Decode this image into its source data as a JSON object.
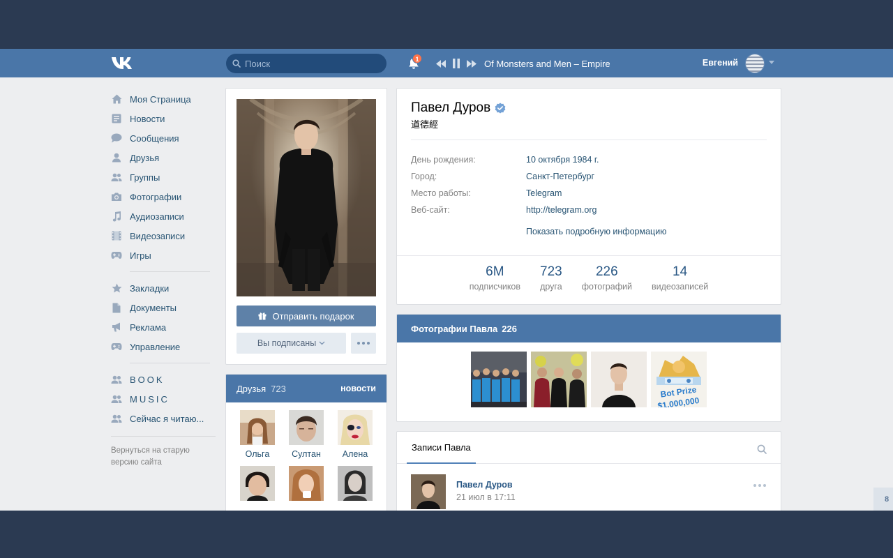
{
  "header": {
    "search_placeholder": "Поиск",
    "notifications_count": "1",
    "track": "Of Monsters and Men – Empire",
    "username": "Евгений"
  },
  "sidebar": {
    "main_items": [
      {
        "label": "Моя Страница",
        "icon": "home-icon"
      },
      {
        "label": "Новости",
        "icon": "news-icon"
      },
      {
        "label": "Сообщения",
        "icon": "messages-icon"
      },
      {
        "label": "Друзья",
        "icon": "friend-icon"
      },
      {
        "label": "Группы",
        "icon": "groups-icon"
      },
      {
        "label": "Фотографии",
        "icon": "camera-icon"
      },
      {
        "label": "Аудиозаписи",
        "icon": "music-note-icon"
      },
      {
        "label": "Видеозаписи",
        "icon": "film-icon"
      },
      {
        "label": "Игры",
        "icon": "gamepad-icon"
      }
    ],
    "secondary_items": [
      {
        "label": "Закладки",
        "icon": "star-icon"
      },
      {
        "label": "Документы",
        "icon": "document-icon"
      },
      {
        "label": "Реклама",
        "icon": "megaphone-icon"
      },
      {
        "label": "Управление",
        "icon": "gamepad-icon"
      }
    ],
    "group_items": [
      {
        "label": "BOOK",
        "icon": "groups-icon"
      },
      {
        "label": "MUSIC",
        "icon": "groups-icon"
      },
      {
        "label": "Сейчас я читаю...",
        "icon": "groups-icon"
      }
    ],
    "old_version": "Вернуться на старую версию сайта"
  },
  "profile": {
    "gift_button": "Отправить подарок",
    "subscribed_button": "Вы подписаны",
    "name": "Павел Дуров",
    "status": "道德經",
    "info": [
      {
        "key": "День рождения:",
        "value": "10 октября 1984 г."
      },
      {
        "key": "Город:",
        "value": "Санкт-Петербург"
      },
      {
        "key": "Место работы:",
        "value": "Telegram"
      },
      {
        "key": "Веб-сайт:",
        "value": "http://telegram.org"
      }
    ],
    "show_more": "Показать подробную информацию",
    "counters": [
      {
        "num": "6M",
        "cap": "подписчиков"
      },
      {
        "num": "723",
        "cap": "друга"
      },
      {
        "num": "226",
        "cap": "фотографий"
      },
      {
        "num": "14",
        "cap": "видеозаписей"
      }
    ]
  },
  "friends": {
    "title": "Друзья",
    "count": "723",
    "news_link": "новости",
    "list": [
      "Ольга",
      "Султан",
      "Алена",
      "",
      "",
      ""
    ]
  },
  "photos": {
    "title": "Фотографии Павла",
    "count": "226",
    "bot_prize_text": "Bot Prize",
    "bot_prize_amount": "$1,000,000"
  },
  "wall": {
    "tab": "Записи Павла",
    "post_author": "Павел Дуров",
    "post_date": "21 июл в 17:11"
  },
  "pager": "8",
  "colors": {
    "header": "#4a76a8",
    "background": "#edeef0",
    "outer": "#2b3a52",
    "link": "#285473",
    "badge": "#ff7349"
  }
}
